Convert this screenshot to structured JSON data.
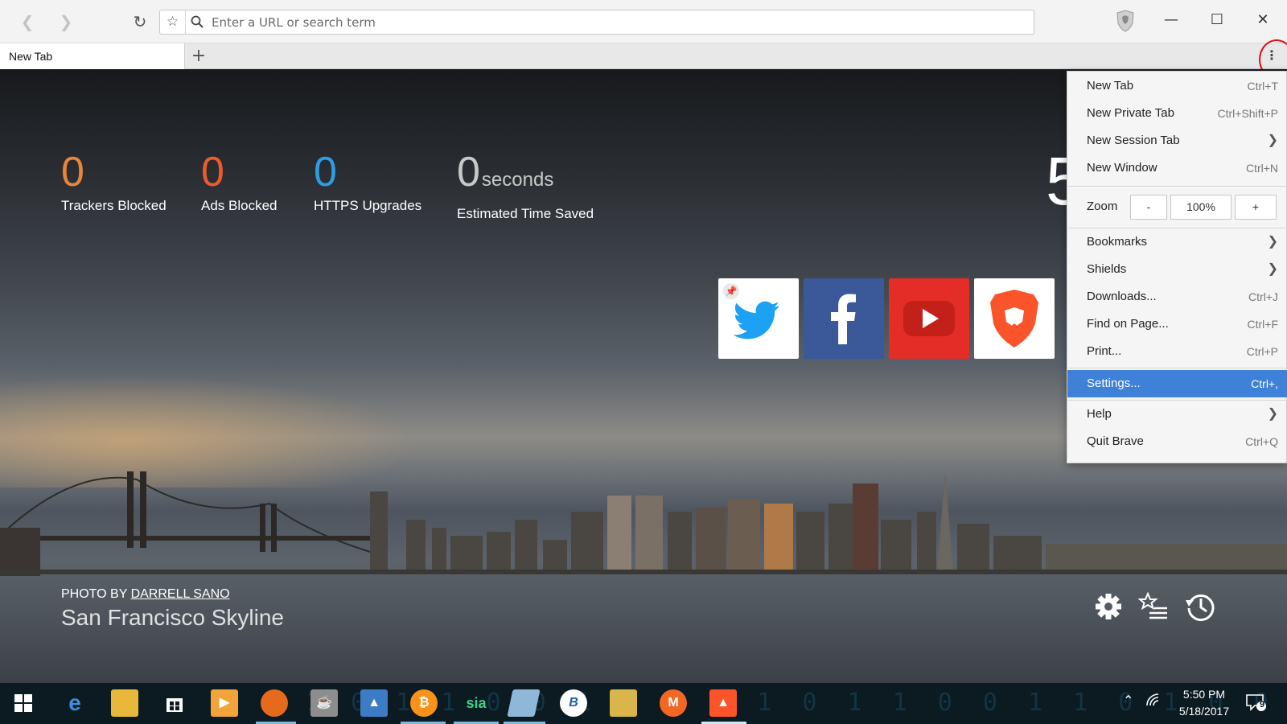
{
  "address_bar": {
    "placeholder": "Enter a URL or search term"
  },
  "tabs": [
    {
      "label": "New Tab"
    }
  ],
  "stats": [
    {
      "value": "0",
      "label": "Trackers Blocked",
      "color": "#e8853b"
    },
    {
      "value": "0",
      "label": "Ads Blocked",
      "color": "#ec5b2c"
    },
    {
      "value": "0",
      "label": "HTTPS Upgrades",
      "color": "#2f9ce3"
    },
    {
      "value": "0",
      "unit": "seconds",
      "label": "Estimated Time Saved",
      "color": "#c8c8c8"
    }
  ],
  "clock_partial": "5",
  "top_sites": [
    {
      "name": "Twitter",
      "pinned": true,
      "bg": "#ffffff"
    },
    {
      "name": "Facebook",
      "bg": "#3b5998"
    },
    {
      "name": "YouTube",
      "bg": "#e52d27"
    },
    {
      "name": "Brave",
      "bg": "#ffffff"
    }
  ],
  "photo_credit": {
    "prefix": "PHOTO BY",
    "author": "DARRELL SANO",
    "title": "San Francisco Skyline"
  },
  "menu": {
    "items": [
      {
        "label": "New Tab",
        "accel": "Ctrl+T"
      },
      {
        "label": "New Private Tab",
        "accel": "Ctrl+Shift+P"
      },
      {
        "label": "New Session Tab",
        "submenu": true
      },
      {
        "label": "New Window",
        "accel": "Ctrl+N"
      },
      {
        "label": "Bookmarks",
        "submenu": true
      },
      {
        "label": "Shields",
        "submenu": true
      },
      {
        "label": "Downloads...",
        "accel": "Ctrl+J"
      },
      {
        "label": "Find on Page...",
        "accel": "Ctrl+F"
      },
      {
        "label": "Print...",
        "accel": "Ctrl+P"
      },
      {
        "label": "Settings...",
        "accel": "Ctrl+,",
        "highlighted": true
      },
      {
        "label": "Help",
        "submenu": true
      },
      {
        "label": "Quit Brave",
        "accel": "Ctrl+Q"
      }
    ],
    "zoom": {
      "label": "Zoom",
      "minus": "-",
      "value": "100%",
      "plus": "+"
    },
    "highlight_color": "#3f80d8"
  },
  "taskbar": {
    "time": "5:50 PM",
    "date": "5/18/2017",
    "notification_count": "9",
    "apps": [
      "start",
      "edge",
      "file-explorer",
      "store",
      "media-player",
      "firefox",
      "java",
      "app-blue",
      "bitcoin",
      "sia",
      "notepad",
      "bittorrent",
      "app-yellow",
      "monero",
      "brave"
    ],
    "sia_label": "sia"
  }
}
